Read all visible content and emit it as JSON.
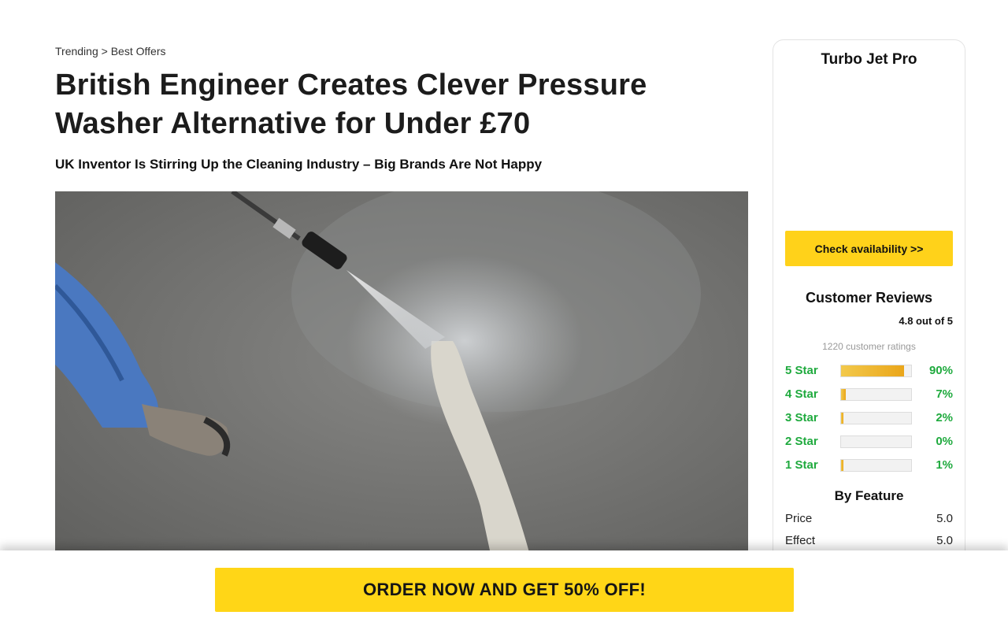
{
  "breadcrumb": {
    "parent": "Trending",
    "separator": ">",
    "current": "Best Offers"
  },
  "article": {
    "headline": "British Engineer Creates Clever Pressure Washer Alternative for Under £70",
    "subheadline": "UK Inventor Is Stirring Up the Cleaning Industry – Big Brands Are Not Happy"
  },
  "sidebar": {
    "product_name": "Turbo Jet Pro",
    "cta_label": "Check availability >>",
    "reviews_title": "Customer Reviews",
    "rating_score": "4.8 out of 5",
    "rating_count": "1220 customer ratings",
    "star_rows": [
      {
        "label": "5 Star",
        "percent_text": "90%",
        "percent": 90
      },
      {
        "label": "4 Star",
        "percent_text": "7%",
        "percent": 7
      },
      {
        "label": "3 Star",
        "percent_text": "2%",
        "percent": 2
      },
      {
        "label": "2 Star",
        "percent_text": "0%",
        "percent": 0
      },
      {
        "label": "1 Star",
        "percent_text": "1%",
        "percent": 1
      }
    ],
    "feature_title": "By Feature",
    "features": [
      {
        "name": "Price",
        "value": "5.0"
      },
      {
        "name": "Effect",
        "value": "5.0"
      }
    ]
  },
  "footer": {
    "cta_label": "ORDER NOW AND GET 50% OFF!"
  },
  "colors": {
    "accent_yellow": "#ffd617",
    "rating_green": "#1faa3e",
    "bar_gold": "#eaa61a"
  }
}
